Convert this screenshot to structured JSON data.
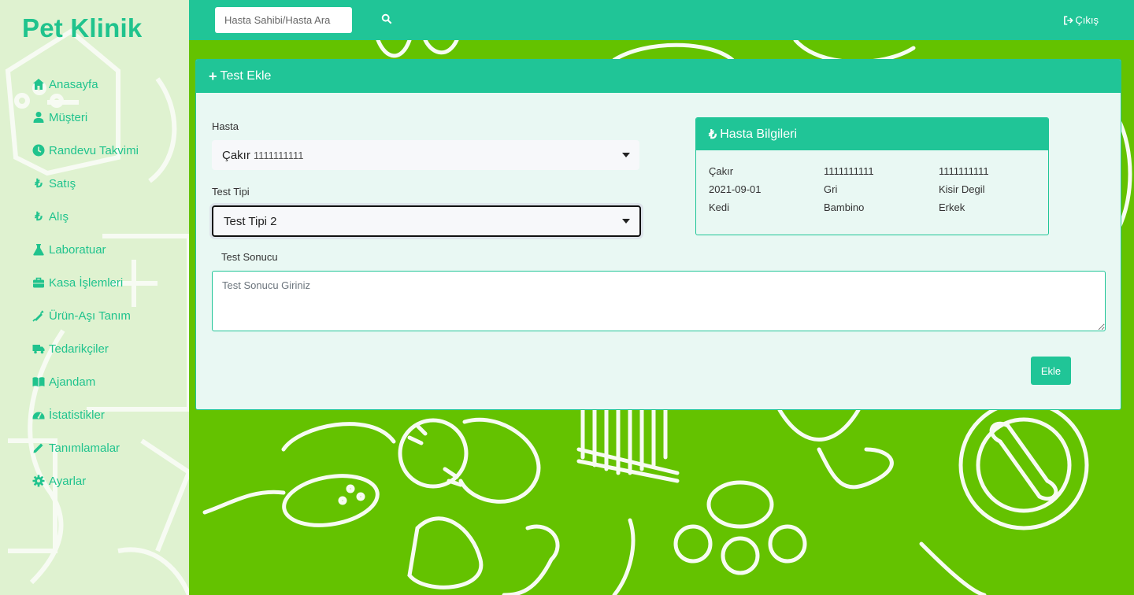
{
  "brand": "Pet Klinik",
  "sidebar": {
    "items": [
      {
        "label": "Anasayfa",
        "icon": "home-icon"
      },
      {
        "label": "Müşteri",
        "icon": "user-icon"
      },
      {
        "label": "Randevu Takvimi",
        "icon": "clock-icon"
      },
      {
        "label": "Satış",
        "icon": "lira-icon"
      },
      {
        "label": "Alış",
        "icon": "lira-icon"
      },
      {
        "label": "Laboratuar",
        "icon": "flask-icon"
      },
      {
        "label": "Kasa İşlemleri",
        "icon": "briefcase-icon"
      },
      {
        "label": "Ürün-Aşı Tanım",
        "icon": "syringe-icon"
      },
      {
        "label": "Tedarikçiler",
        "icon": "truck-icon"
      },
      {
        "label": "Ajandam",
        "icon": "book-icon"
      },
      {
        "label": "İstatistikler",
        "icon": "gauge-icon"
      },
      {
        "label": "Tanımlamalar",
        "icon": "pencil-icon"
      },
      {
        "label": "Ayarlar",
        "icon": "gear-icon"
      }
    ]
  },
  "topbar": {
    "search_placeholder": "Hasta Sahibi/Hasta Ara",
    "logout_label": "Çıkış"
  },
  "form": {
    "title": "Test Ekle",
    "patient_label": "Hasta",
    "patient_name": "Çakır",
    "patient_id": "1111111111",
    "test_type_label": "Test Tipi",
    "test_type_value": "Test Tipi 2",
    "result_label": "Test Sonucu",
    "result_placeholder": "Test Sonucu Giriniz",
    "submit_label": "Ekle"
  },
  "patient_info": {
    "title": "Hasta Bilgileri",
    "rows": [
      [
        "Çakır",
        "1111111111",
        "1111111111"
      ],
      [
        "2021-09-01",
        "Gri",
        "Kisir Degil"
      ],
      [
        "Kedi",
        "Bambino",
        "Erkek"
      ]
    ]
  },
  "colors": {
    "accent": "#20c597",
    "sidebar_bg": "#dff2d0",
    "page_bg": "#64c200"
  }
}
